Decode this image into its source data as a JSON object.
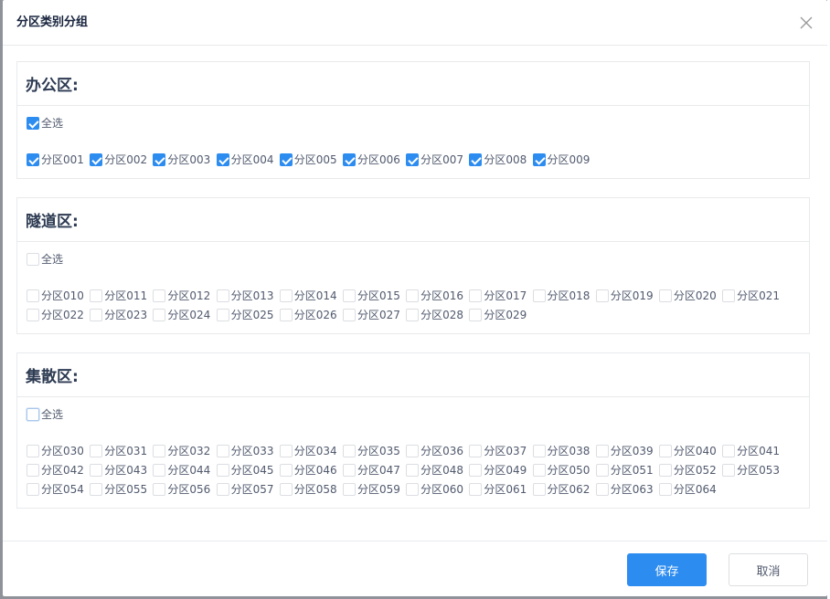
{
  "dialog": {
    "title": "分区类别分组",
    "save_label": "保存",
    "cancel_label": "取消"
  },
  "groups": [
    {
      "title": "办公区:",
      "select_all": {
        "label": "全选",
        "checked": true
      },
      "items": [
        {
          "label": "分区001",
          "checked": true
        },
        {
          "label": "分区002",
          "checked": true
        },
        {
          "label": "分区003",
          "checked": true
        },
        {
          "label": "分区004",
          "checked": true
        },
        {
          "label": "分区005",
          "checked": true
        },
        {
          "label": "分区006",
          "checked": true
        },
        {
          "label": "分区007",
          "checked": true
        },
        {
          "label": "分区008",
          "checked": true
        },
        {
          "label": "分区009",
          "checked": true
        }
      ]
    },
    {
      "title": "隧道区:",
      "select_all": {
        "label": "全选",
        "checked": false
      },
      "items": [
        {
          "label": "分区010",
          "checked": false
        },
        {
          "label": "分区011",
          "checked": false
        },
        {
          "label": "分区012",
          "checked": false
        },
        {
          "label": "分区013",
          "checked": false
        },
        {
          "label": "分区014",
          "checked": false
        },
        {
          "label": "分区015",
          "checked": false
        },
        {
          "label": "分区016",
          "checked": false
        },
        {
          "label": "分区017",
          "checked": false
        },
        {
          "label": "分区018",
          "checked": false
        },
        {
          "label": "分区019",
          "checked": false
        },
        {
          "label": "分区020",
          "checked": false
        },
        {
          "label": "分区021",
          "checked": false
        },
        {
          "label": "分区022",
          "checked": false
        },
        {
          "label": "分区023",
          "checked": false
        },
        {
          "label": "分区024",
          "checked": false
        },
        {
          "label": "分区025",
          "checked": false
        },
        {
          "label": "分区026",
          "checked": false
        },
        {
          "label": "分区027",
          "checked": false
        },
        {
          "label": "分区028",
          "checked": false
        },
        {
          "label": "分区029",
          "checked": false
        }
      ]
    },
    {
      "title": "集散区:",
      "select_all": {
        "label": "全选",
        "checked": false
      },
      "items": [
        {
          "label": "分区030",
          "checked": false
        },
        {
          "label": "分区031",
          "checked": false
        },
        {
          "label": "分区032",
          "checked": false
        },
        {
          "label": "分区033",
          "checked": false
        },
        {
          "label": "分区034",
          "checked": false
        },
        {
          "label": "分区035",
          "checked": false
        },
        {
          "label": "分区036",
          "checked": false
        },
        {
          "label": "分区037",
          "checked": false
        },
        {
          "label": "分区038",
          "checked": false
        },
        {
          "label": "分区039",
          "checked": false
        },
        {
          "label": "分区040",
          "checked": false
        },
        {
          "label": "分区041",
          "checked": false
        },
        {
          "label": "分区042",
          "checked": false
        },
        {
          "label": "分区043",
          "checked": false
        },
        {
          "label": "分区044",
          "checked": false
        },
        {
          "label": "分区045",
          "checked": false
        },
        {
          "label": "分区046",
          "checked": false
        },
        {
          "label": "分区047",
          "checked": false
        },
        {
          "label": "分区048",
          "checked": false
        },
        {
          "label": "分区049",
          "checked": false
        },
        {
          "label": "分区050",
          "checked": false
        },
        {
          "label": "分区051",
          "checked": false
        },
        {
          "label": "分区052",
          "checked": false
        },
        {
          "label": "分区053",
          "checked": false
        },
        {
          "label": "分区054",
          "checked": false
        },
        {
          "label": "分区055",
          "checked": false
        },
        {
          "label": "分区056",
          "checked": false
        },
        {
          "label": "分区057",
          "checked": false
        },
        {
          "label": "分区058",
          "checked": false
        },
        {
          "label": "分区059",
          "checked": false
        },
        {
          "label": "分区060",
          "checked": false
        },
        {
          "label": "分区061",
          "checked": false
        },
        {
          "label": "分区062",
          "checked": false
        },
        {
          "label": "分区063",
          "checked": false
        },
        {
          "label": "分区064",
          "checked": false
        }
      ]
    }
  ],
  "colors": {
    "primary": "#2d8cf0",
    "border": "#e8eaec",
    "text": "#515a6e"
  },
  "icons": {
    "close": "close-icon",
    "check": "checkmark-icon"
  }
}
